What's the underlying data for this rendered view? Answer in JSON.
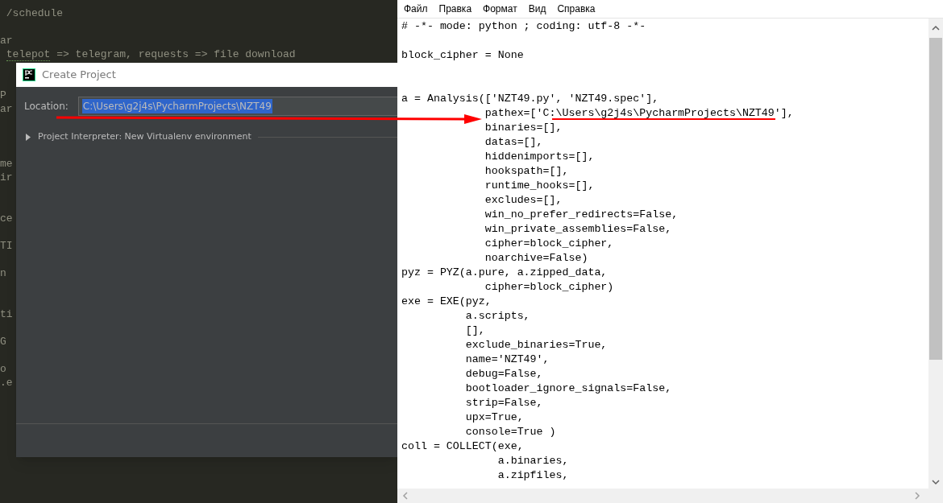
{
  "editor": {
    "lines": [
      {
        "text": " /schedule",
        "squiggle": false
      },
      {
        "text": "ar",
        "squiggle": false
      },
      {
        "text": " telepot => telegram, requests => file download",
        "squiggle": true
      },
      {
        "text": "P",
        "squiggle": false
      },
      {
        "text": "ar",
        "squiggle": false
      },
      {
        "text": "me",
        "squiggle": false
      },
      {
        "text": "ir",
        "squiggle": false
      },
      {
        "text": "ce",
        "squiggle": false
      },
      {
        "text": "TI",
        "squiggle": false
      },
      {
        "text": "n",
        "squiggle": false
      },
      {
        "text": "ti",
        "squiggle": false
      },
      {
        "text": "G",
        "squiggle": false
      },
      {
        "text": "o",
        "squiggle": false
      },
      {
        "text": ".e",
        "squiggle": false
      }
    ]
  },
  "dialog": {
    "title": "Create Project",
    "location_label": "Location:",
    "location_value": "C:\\Users\\g2j4s\\PycharmProjects\\NZT49",
    "location_selected": true,
    "interpreter": {
      "label": "Project Interpreter: New Virtualenv environment",
      "expanded": false
    }
  },
  "notepad": {
    "menu": [
      "Файл",
      "Правка",
      "Формат",
      "Вид",
      "Справка"
    ],
    "lines": [
      "# -*- mode: python ; coding: utf-8 -*-",
      "block_cipher = None",
      "a = Analysis(['NZT49.py', 'NZT49.spec'],",
      "             pathex=['C:\\Users\\g2j4s\\PycharmProjects\\NZT49'],",
      "             binaries=[],",
      "             datas=[],",
      "             hiddenimports=[],",
      "             hookspath=[],",
      "             runtime_hooks=[],",
      "             excludes=[],",
      "             win_no_prefer_redirects=False,",
      "             win_private_assemblies=False,",
      "             cipher=block_cipher,",
      "             noarchive=False)",
      "pyz = PYZ(a.pure, a.zipped_data,",
      "             cipher=block_cipher)",
      "exe = EXE(pyz,",
      "          a.scripts,",
      "          [],",
      "          exclude_binaries=True,",
      "          name='NZT49',",
      "          debug=False,",
      "          bootloader_ignore_signals=False,",
      "          strip=False,",
      "          upx=True,",
      "          console=True )",
      "coll = COLLECT(exe,",
      "               a.binaries,",
      "               a.zipfiles,"
    ]
  }
}
